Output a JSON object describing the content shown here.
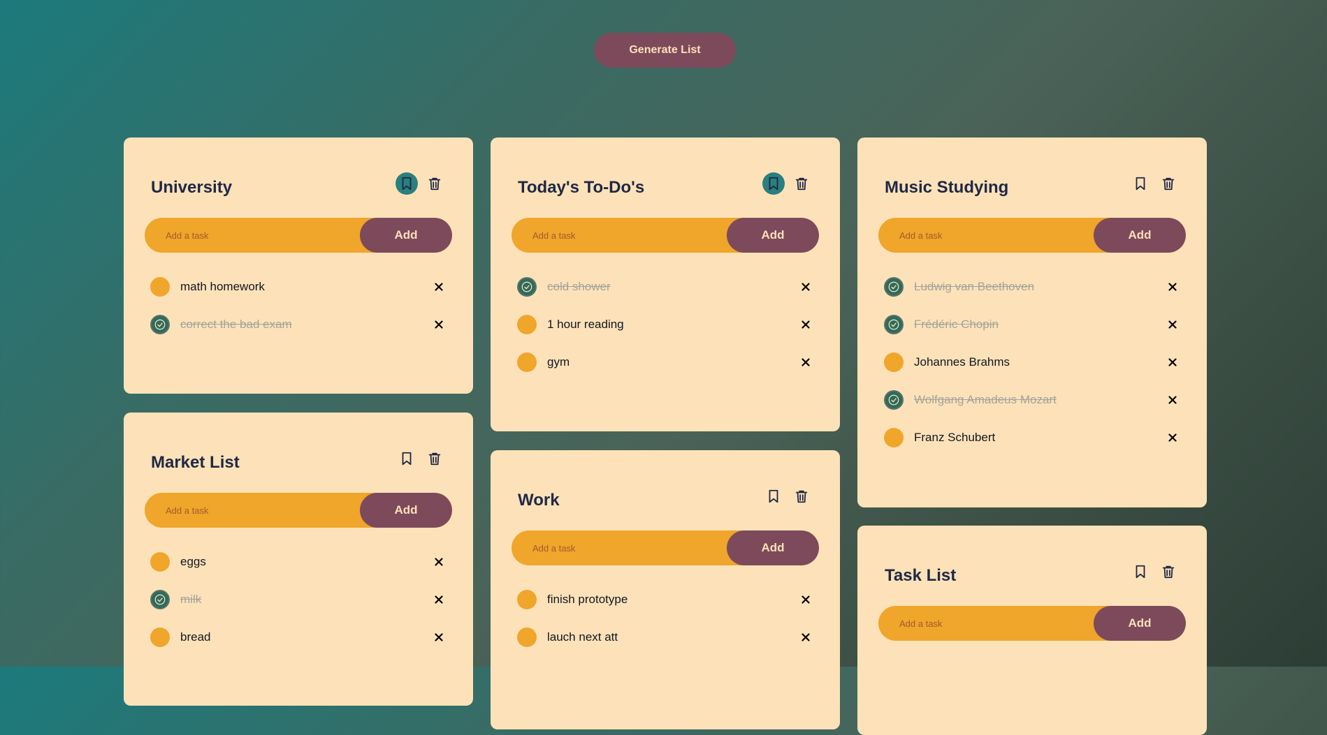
{
  "generate_label": "Generate List",
  "add_placeholder": "Add a task",
  "add_label": "Add",
  "lists": {
    "university": {
      "title": "University",
      "bookmarked": true,
      "tasks": [
        {
          "text": "math homework",
          "done": false
        },
        {
          "text": "correct the bad exam",
          "done": true
        }
      ]
    },
    "market": {
      "title": "Market List",
      "bookmarked": false,
      "tasks": [
        {
          "text": "eggs",
          "done": false
        },
        {
          "text": "milk",
          "done": true
        },
        {
          "text": "bread",
          "done": false
        }
      ]
    },
    "today": {
      "title": "Today's To-Do's",
      "bookmarked": true,
      "tasks": [
        {
          "text": "cold shower",
          "done": true
        },
        {
          "text": "1 hour reading",
          "done": false
        },
        {
          "text": "gym",
          "done": false
        }
      ]
    },
    "work": {
      "title": "Work",
      "bookmarked": false,
      "tasks": [
        {
          "text": "finish prototype",
          "done": false
        },
        {
          "text": "lauch next att",
          "done": false
        }
      ]
    },
    "music": {
      "title": "Music Studying",
      "bookmarked": false,
      "tasks": [
        {
          "text": "Ludwig van Beethoven",
          "done": true
        },
        {
          "text": "Frédéric Chopin",
          "done": true
        },
        {
          "text": "Johannes Brahms",
          "done": false
        },
        {
          "text": "Wolfgang Amadeus Mozart",
          "done": true
        },
        {
          "text": "Franz Schubert",
          "done": false
        }
      ]
    },
    "tasklist": {
      "title": "Task List",
      "bookmarked": false,
      "tasks": []
    }
  }
}
